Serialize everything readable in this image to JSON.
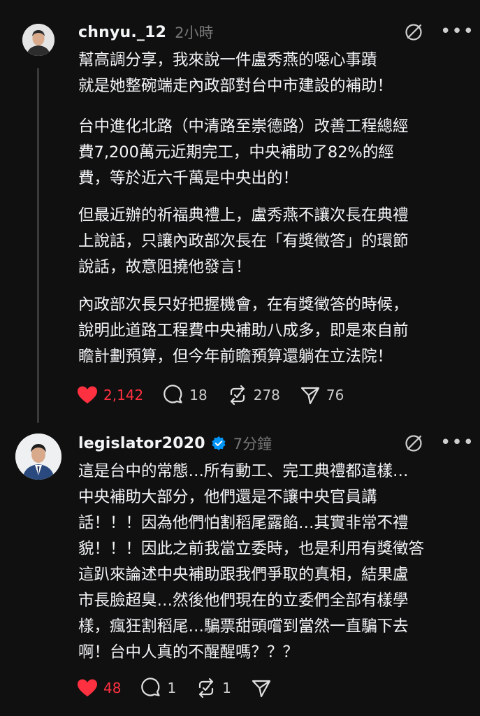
{
  "posts": [
    {
      "username": "chnyu._12",
      "time": "2小時",
      "paragraphs": [
        "幫高調分享，我來說一件盧秀燕的噁心事蹟\n就是她整碗端走內政部對台中市建設的補助！",
        "台中進化北路（中清路至崇德路）改善工程總經\n費7,200萬元近期完工，中央補助了82%的經\n費，等於近六千萬是中央出的！",
        "但最近辦的祈福典禮上，盧秀燕不讓次長在典禮\n上說話，只讓內政部次長在「有獎徵答」的環節\n說話，故意阻撓他發言！",
        "內政部次長只好把握機會，在有獎徵答的時候，\n說明此道路工程費中央補助八成多，即是來自前\n瞻計劃預算，但今年前瞻預算還躺在立法院！"
      ],
      "likes": "2,142",
      "comments": "18",
      "reposts": "278",
      "shares": "76",
      "more_icon": "more-dots-icon",
      "extra_icon": "no-camera-icon"
    },
    {
      "username": "legislator2020",
      "time": "7分鐘",
      "paragraphs": [
        "這是台中的常態…所有動工、完工典禮都這樣…\n中央補助大部分，他們還是不讓中央官員講\n話！！！因為他們怕割稻尾露餡…其實非常不禮\n貌！！！因此之前我當立委時，也是利用有獎徵答\n這趴來論述中央補助跟我們爭取的真相，結果盧\n市長臉超臭…然後他們現在的立委們全部有樣學\n樣，瘋狂割稻尾…騙票甜頭嚐到當然一直騙下去\n啊！台中人真的不醒醒嗎？？？"
      ],
      "likes": "48",
      "comments": "1",
      "reposts": "1",
      "shares": ""
    }
  ],
  "colors": {
    "background": "#101010",
    "text": "#f3f5f7",
    "muted": "#777777",
    "like": "#ff3040",
    "verified": "#0095f6"
  }
}
